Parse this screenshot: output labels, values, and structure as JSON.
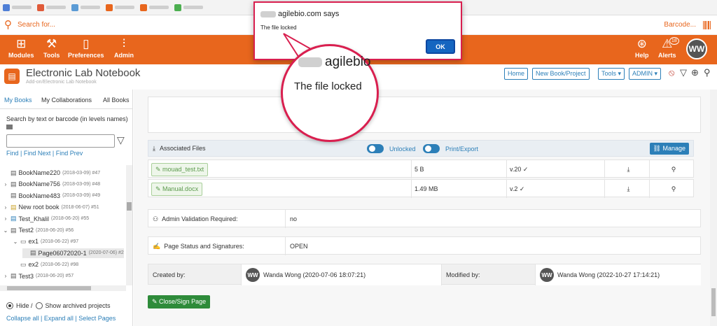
{
  "bookmarks": [
    {
      "color": "#4f7fd6"
    },
    {
      "color": "#e05b3a"
    },
    {
      "color": "#5b9bd5"
    },
    {
      "color": "#e8661d"
    },
    {
      "color": "#e8661d"
    },
    {
      "color": "#4caf50"
    }
  ],
  "search": {
    "placeholder": "Search for...",
    "barcode_label": "Barcode..."
  },
  "topnav": {
    "modules": "Modules",
    "tools": "Tools",
    "preferences": "Preferences",
    "admin": "Admin",
    "help": "Help",
    "alerts": "Alerts",
    "alerts_count": "18",
    "avatar": "WW"
  },
  "header": {
    "title": "Electronic Lab Notebook",
    "subtitle": "Add-on/Electronic Lab Notebook",
    "buttons": {
      "home": "Home",
      "new_book": "New Book/Project",
      "tools": "Tools",
      "admin": "ADMIN"
    }
  },
  "sidebar": {
    "tabs": [
      "My Books",
      "My Collaborations",
      "All Books"
    ],
    "search_label": "Search by text or barcode (in levels names)",
    "links": "Find | Find Next | Find Prev",
    "tree": [
      {
        "name": "BookName220",
        "date": "(2018-03-09) #47",
        "indent": 0,
        "toggle": ""
      },
      {
        "name": "BookName756",
        "date": "(2018-03-09) #48",
        "indent": 0,
        "toggle": "›"
      },
      {
        "name": "BookName483",
        "date": "(2018-03-09) #49",
        "indent": 0,
        "toggle": ""
      },
      {
        "name": "New root book",
        "date": "(2018-06-07) #51",
        "indent": 0,
        "toggle": "›"
      },
      {
        "name": "Test_Khalil",
        "date": "(2018-06-20) #55",
        "indent": 0,
        "toggle": "›"
      },
      {
        "name": "Test2",
        "date": "(2018-06-20) #56",
        "indent": 0,
        "toggle": "⌄"
      },
      {
        "name": "ex1",
        "date": "(2018-06-22) #97",
        "indent": 1,
        "toggle": "⌄"
      },
      {
        "name": "Page06072020-1",
        "date": "(2020-07-06) #2",
        "indent": 2,
        "toggle": ""
      },
      {
        "name": "ex2",
        "date": "(2018-06-22) #98",
        "indent": 1,
        "toggle": ""
      },
      {
        "name": "Test3",
        "date": "(2018-06-20) #57",
        "indent": 0,
        "toggle": "›"
      }
    ],
    "hide_label": "Hide /",
    "show_archived": "Show archived projects",
    "footer_links": "Collapse all | Expand all | Select Pages"
  },
  "main": {
    "assoc_files": "Associated Files",
    "unlocked": "Unlocked",
    "print_export": "Print/Export",
    "manage": "Manage",
    "files": [
      {
        "name": "mouad_test.txt",
        "size": "5 B",
        "version": "v.20 ✓"
      },
      {
        "name": "Manual.docx",
        "size": "1.49 MB",
        "version": "v.2 ✓"
      }
    ],
    "validation_label": "Admin Validation Required:",
    "validation_value": "no",
    "status_label": "Page Status and Signatures:",
    "status_value": "OPEN",
    "created_label": "Created by:",
    "created_value": "Wanda Wong (2020-07-06 18:07:21)",
    "modified_label": "Modified by:",
    "modified_value": "Wanda Wong (2022-10-27 17:14:21)",
    "avatar": "WW",
    "close_sign": "Close/Sign Page"
  },
  "dialog": {
    "host": "agilebio.com says",
    "message": "The file locked",
    "ok": "OK"
  },
  "zoom": {
    "host": "agilebio",
    "message": "The file locked"
  }
}
